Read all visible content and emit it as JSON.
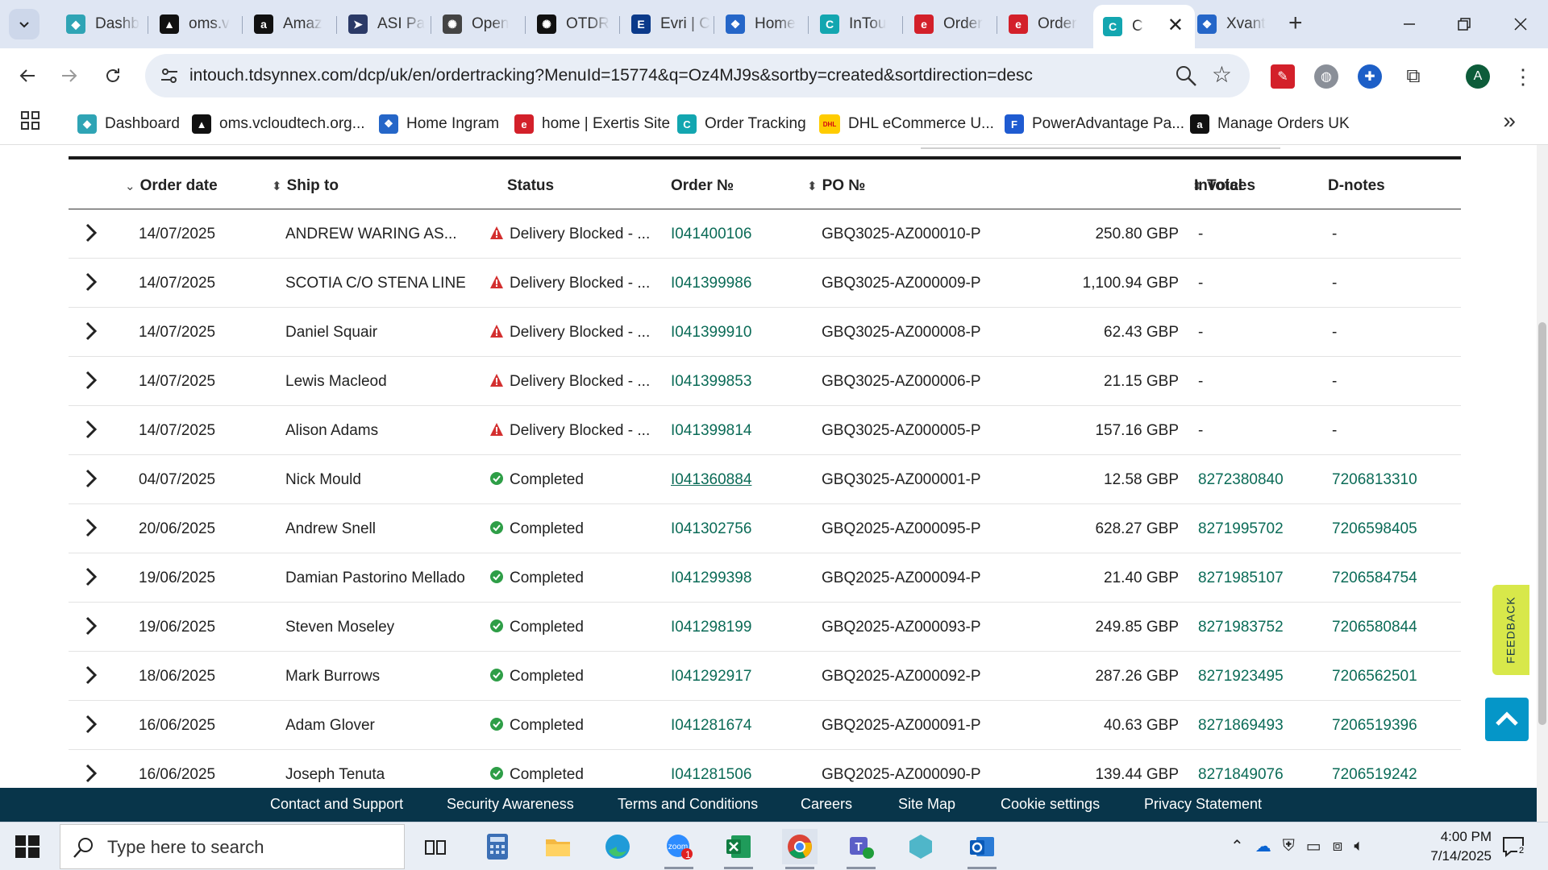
{
  "tabs": [
    {
      "label": "Dashb",
      "fav": "◆",
      "color": "#2fa4b5"
    },
    {
      "label": "oms.v",
      "fav": "▲",
      "color": "#111111"
    },
    {
      "label": "Amaz",
      "fav": "a",
      "color": "#111111"
    },
    {
      "label": "ASI Pa",
      "fav": "➤",
      "color": "#2b3a67"
    },
    {
      "label": "Open",
      "fav": "✺",
      "color": "#444444"
    },
    {
      "label": "OTDR",
      "fav": "✺",
      "color": "#111111"
    },
    {
      "label": "Evri | C",
      "fav": "E",
      "color": "#0b3a8a"
    },
    {
      "label": "Home",
      "fav": "❖",
      "color": "#2566c8"
    },
    {
      "label": "InTou",
      "fav": "C",
      "color": "#13a6b0"
    },
    {
      "label": "Order",
      "fav": "e",
      "color": "#d3202a"
    },
    {
      "label": "Order",
      "fav": "e",
      "color": "#d3202a"
    },
    {
      "label": "C",
      "fav": "C",
      "color": "#13a6b0"
    },
    {
      "label": "Xvant",
      "fav": "❖",
      "color": "#2566c8"
    }
  ],
  "url": "intouch.tdsynnex.com/dcp/uk/en/ordertracking?MenuId=15774&q=Oz4MJ9s&sortby=created&sortdirection=desc",
  "profile_initial": "A",
  "bookmarks": [
    {
      "label": "Dashboard",
      "fav": "◆",
      "color": "#2fa4b5"
    },
    {
      "label": "oms.vcloudtech.org...",
      "fav": "▲",
      "color": "#111111"
    },
    {
      "label": "Home Ingram",
      "fav": "❖",
      "color": "#2566c8"
    },
    {
      "label": "home | Exertis Site",
      "fav": "e",
      "color": "#d3202a"
    },
    {
      "label": "Order Tracking",
      "fav": "C",
      "color": "#13a6b0"
    },
    {
      "label": "DHL eCommerce U...",
      "fav": "DHL",
      "color": "#ffcc00"
    },
    {
      "label": "PowerAdvantage Pa...",
      "fav": "F",
      "color": "#1f5bd1"
    },
    {
      "label": "Manage Orders UK",
      "fav": "a",
      "color": "#111111"
    }
  ],
  "table": {
    "headers": {
      "order_date": "Order date",
      "ship_to": "Ship to",
      "status": "Status",
      "order_no": "Order №",
      "po_no": "PO №",
      "total": "Total",
      "invoices": "Invoices",
      "dnotes": "D-notes"
    },
    "rows": [
      {
        "date": "14/07/2025",
        "ship": "ANDREW WARING AS...",
        "status": "Delivery Blocked - ...",
        "state": "blocked",
        "order": "I041400106",
        "po": "GBQ3025-AZ000010-P",
        "total": "250.80 GBP",
        "invoice": "-",
        "dnote": "-"
      },
      {
        "date": "14/07/2025",
        "ship": "SCOTIA C/O STENA LINE",
        "status": "Delivery Blocked - ...",
        "state": "blocked",
        "order": "I041399986",
        "po": "GBQ3025-AZ000009-P",
        "total": "1,100.94 GBP",
        "invoice": "-",
        "dnote": "-"
      },
      {
        "date": "14/07/2025",
        "ship": "Daniel Squair",
        "status": "Delivery Blocked - ...",
        "state": "blocked",
        "order": "I041399910",
        "po": "GBQ3025-AZ000008-P",
        "total": "62.43 GBP",
        "invoice": "-",
        "dnote": "-"
      },
      {
        "date": "14/07/2025",
        "ship": "Lewis Macleod",
        "status": "Delivery Blocked - ...",
        "state": "blocked",
        "order": "I041399853",
        "po": "GBQ3025-AZ000006-P",
        "total": "21.15 GBP",
        "invoice": "-",
        "dnote": "-"
      },
      {
        "date": "14/07/2025",
        "ship": "Alison Adams",
        "status": "Delivery Blocked - ...",
        "state": "blocked",
        "order": "I041399814",
        "po": "GBQ3025-AZ000005-P",
        "total": "157.16 GBP",
        "invoice": "-",
        "dnote": "-"
      },
      {
        "date": "04/07/2025",
        "ship": "Nick Mould",
        "status": "Completed",
        "state": "completed",
        "order": "I041360884",
        "po": "GBQ3025-AZ000001-P",
        "total": "12.58 GBP",
        "invoice": "8272380840",
        "dnote": "7206813310",
        "underline": true
      },
      {
        "date": "20/06/2025",
        "ship": "Andrew Snell",
        "status": "Completed",
        "state": "completed",
        "order": "I041302756",
        "po": "GBQ2025-AZ000095-P",
        "total": "628.27 GBP",
        "invoice": "8271995702",
        "dnote": "7206598405"
      },
      {
        "date": "19/06/2025",
        "ship": "Damian Pastorino Mellado",
        "status": "Completed",
        "state": "completed",
        "order": "I041299398",
        "po": "GBQ2025-AZ000094-P",
        "total": "21.40 GBP",
        "invoice": "8271985107",
        "dnote": "7206584754"
      },
      {
        "date": "19/06/2025",
        "ship": "Steven Moseley",
        "status": "Completed",
        "state": "completed",
        "order": "I041298199",
        "po": "GBQ2025-AZ000093-P",
        "total": "249.85 GBP",
        "invoice": "8271983752",
        "dnote": "7206580844"
      },
      {
        "date": "18/06/2025",
        "ship": "Mark Burrows",
        "status": "Completed",
        "state": "completed",
        "order": "I041292917",
        "po": "GBQ2025-AZ000092-P",
        "total": "287.26 GBP",
        "invoice": "8271923495",
        "dnote": "7206562501"
      },
      {
        "date": "16/06/2025",
        "ship": "Adam Glover",
        "status": "Completed",
        "state": "completed",
        "order": "I041281674",
        "po": "GBQ2025-AZ000091-P",
        "total": "40.63 GBP",
        "invoice": "8271869493",
        "dnote": "7206519396"
      },
      {
        "date": "16/06/2025",
        "ship": "Joseph Tenuta",
        "status": "Completed",
        "state": "completed",
        "order": "I041281506",
        "po": "GBQ2025-AZ000090-P",
        "total": "139.44 GBP",
        "invoice": "8271849076",
        "dnote": "7206519242"
      }
    ]
  },
  "footer_links": [
    "Contact and Support",
    "Security Awareness",
    "Terms and Conditions",
    "Careers",
    "Site Map",
    "Cookie settings",
    "Privacy Statement"
  ],
  "feedback_label": "FEEDBACK",
  "taskbar": {
    "search_placeholder": "Type here to search",
    "time": "4:00 PM",
    "date": "7/14/2025",
    "notification_count": "2",
    "zoom_badge": "1"
  },
  "colors": {
    "link": "#0b6b57",
    "blocked": "#d32f2f",
    "completed": "#2e9e47",
    "footer": "#08354a",
    "accent": "#0596c8"
  }
}
